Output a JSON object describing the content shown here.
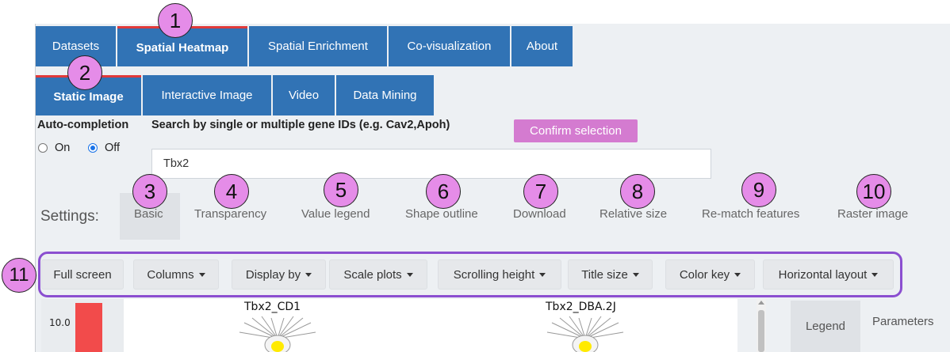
{
  "nav": {
    "main_tabs": [
      {
        "label": "Datasets"
      },
      {
        "label": "Spatial Heatmap"
      },
      {
        "label": "Spatial Enrichment"
      },
      {
        "label": "Co-visualization"
      },
      {
        "label": "About"
      }
    ],
    "sub_tabs": [
      {
        "label": "Static Image"
      },
      {
        "label": "Interactive Image"
      },
      {
        "label": "Video"
      },
      {
        "label": "Data Mining"
      }
    ]
  },
  "callouts": [
    "1",
    "2",
    "3",
    "4",
    "5",
    "6",
    "7",
    "8",
    "9",
    "10",
    "11"
  ],
  "search": {
    "autocomplete_label": "Auto-completion",
    "on_label": "On",
    "off_label": "Off",
    "selected": "Off",
    "search_label": "Search by single or multiple gene IDs (e.g. Cav2,Apoh)",
    "confirm_label": "Confirm selection",
    "value": "Tbx2"
  },
  "settings": {
    "label": "Settings:",
    "tabs": [
      {
        "label": "Basic"
      },
      {
        "label": "Transparency"
      },
      {
        "label": "Value legend"
      },
      {
        "label": "Shape outline"
      },
      {
        "label": "Download"
      },
      {
        "label": "Relative size"
      },
      {
        "label": "Re-match features"
      },
      {
        "label": "Raster image"
      }
    ]
  },
  "toolbar": {
    "buttons": [
      {
        "label": "Full screen"
      },
      {
        "label": "Columns"
      },
      {
        "label": "Display by"
      },
      {
        "label": "Scale plots"
      },
      {
        "label": "Scrolling height"
      },
      {
        "label": "Title size"
      },
      {
        "label": "Color key"
      },
      {
        "label": "Horizontal layout"
      }
    ]
  },
  "plot": {
    "color_key_tick": "10.0",
    "titles": [
      "Tbx2_CD1",
      "Tbx2_DBA.2J"
    ]
  },
  "side_panel": {
    "legend_label": "Legend",
    "parameters_label": "Parameters"
  },
  "colors": {
    "tab_blue": "#3173b5",
    "active_underline": "#e03a3a",
    "callout_pink": "#e58ce8",
    "confirm_button": "#d47bd0",
    "toolbar_outline": "#8b4fd0",
    "color_key_red": "#f24b4b"
  }
}
